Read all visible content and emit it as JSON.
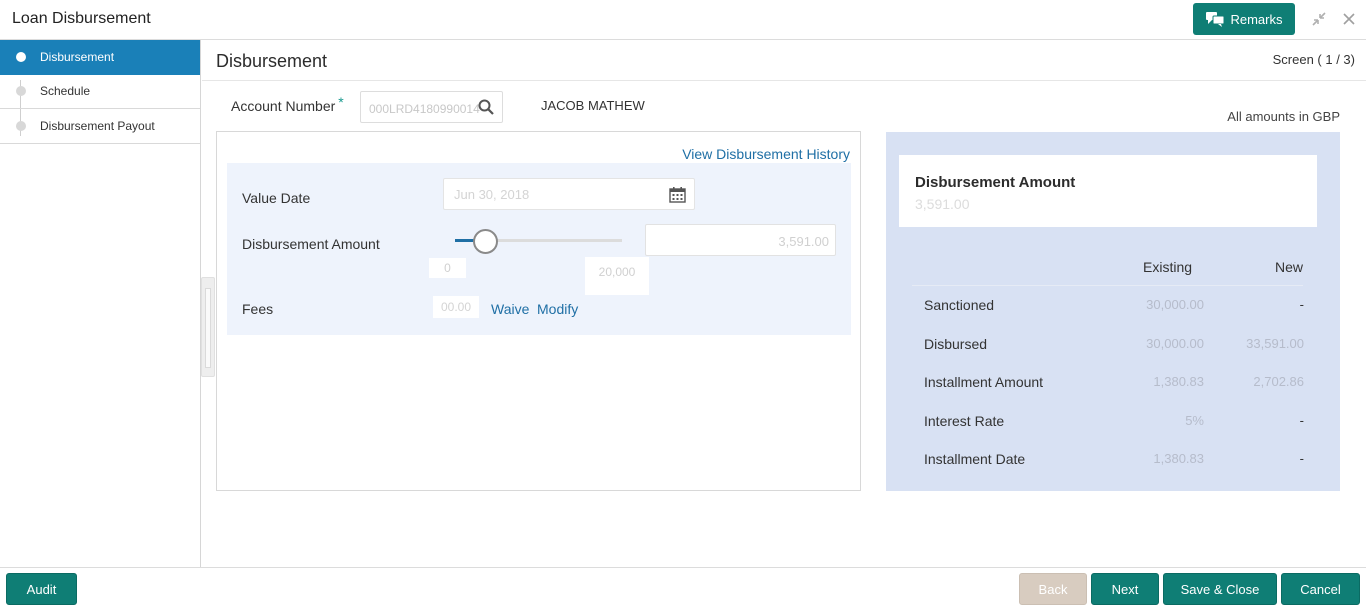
{
  "window": {
    "title": "Loan Disbursement",
    "remarks_label": "Remarks"
  },
  "sidebar": {
    "items": [
      {
        "label": "Disbursement",
        "active": true
      },
      {
        "label": "Schedule",
        "active": false
      },
      {
        "label": "Disbursement Payout",
        "active": false
      }
    ]
  },
  "page": {
    "title": "Disbursement",
    "screen_indicator": "Screen ( 1 / 3)"
  },
  "account": {
    "label": "Account Number",
    "required_mark": "*",
    "value": "000LRD4180990014",
    "customer_name": "JACOB MATHEW"
  },
  "currency_note": "All amounts in GBP",
  "form": {
    "history_link": "View Disbursement History",
    "value_date_label": "Value Date",
    "value_date": "Jun 30, 2018",
    "amount_label": "Disbursement Amount",
    "amount_value": "3,591.00",
    "slider_min": "0",
    "slider_max": "20,000",
    "slider_level": 0.18,
    "fees_label": "Fees",
    "fees_value": "00.00",
    "waive_label": "Waive",
    "modify_label": "Modify"
  },
  "summary": {
    "title": "Disbursement Amount",
    "amount": "3,591.00",
    "col_existing": "Existing",
    "col_new": "New",
    "rows": [
      {
        "label": "Sanctioned",
        "existing": "30,000.00",
        "new": "-"
      },
      {
        "label": "Disbursed",
        "existing": "30,000.00",
        "new": "33,591.00"
      },
      {
        "label": "Installment Amount",
        "existing": "1,380.83",
        "new": "2,702.86"
      },
      {
        "label": "Interest Rate",
        "existing": "5%",
        "new": "-"
      },
      {
        "label": "Installment Date",
        "existing": "1,380.83",
        "new": "-"
      }
    ]
  },
  "footer": {
    "audit": "Audit",
    "back": "Back",
    "next": "Next",
    "save_close": "Save & Close",
    "cancel": "Cancel"
  },
  "colors": {
    "primary": "#0f7e75",
    "active_step": "#1a80b8",
    "link": "#1f6fa5",
    "panel": "#d8e1f3"
  },
  "icons": [
    "remarks-icon",
    "minimize-icon",
    "close-icon",
    "search-icon",
    "calendar-icon"
  ]
}
